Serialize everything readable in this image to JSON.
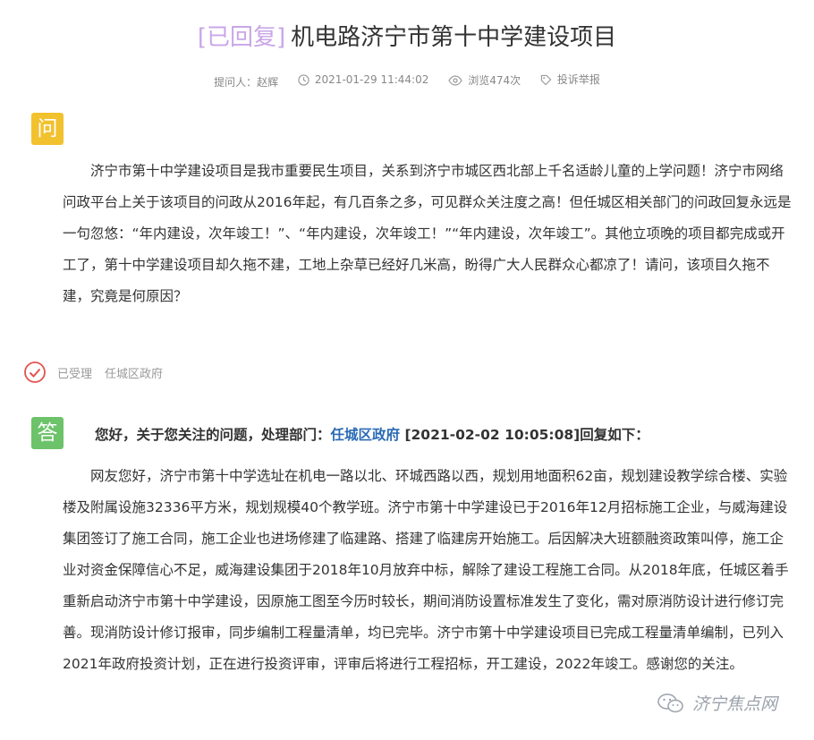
{
  "header": {
    "status_tag": "[已回复]",
    "title": "机电路济宁市第十中学建设项目"
  },
  "meta": {
    "asker": "提问人：赵辉",
    "datetime": "2021-01-29 11:44:02",
    "views": "浏览474次",
    "report": "投诉举报"
  },
  "question": {
    "badge": "问",
    "body": "济宁市第十中学建设项目是我市重要民生项目，关系到济宁市城区西北部上千名适龄儿童的上学问题！济宁市网络问政平台上关于该项目的问政从2016年起，有几百条之多，可见群众关注度之高！但任城区相关部门的问政回复永远是一句忽悠：“年内建设，次年竣工！”、“年内建设，次年竣工！”“年内建设，次年竣工”。其他立项晚的项目都完成或开工了，第十中学建设项目却久拖不建，工地上杂草已经好几米高，盼得广大人民群众心都凉了！请问，该项目久拖不建，究竟是何原因？"
  },
  "status": {
    "accepted": "已受理",
    "department": "任城区政府"
  },
  "answer": {
    "badge": "答",
    "head_prefix": "您好，关于您关注的问题，处理部门：",
    "head_department": "任城区政府",
    "head_suffix": "[2021-02-02 10:05:08]回复如下：",
    "body": "网友您好，济宁市第十中学选址在机电一路以北、环城西路以西，规划用地面积62亩，规划建设教学综合楼、实验楼及附属设施32336平方米，规划规模40个教学班。济宁市第十中学建设已于2016年12月招标施工企业，与威海建设集团签订了施工合同，施工企业也进场修建了临建路、搭建了临建房开始施工。后因解决大班额融资政策叫停，施工企业对资金保障信心不足，威海建设集团于2018年10月放弃中标，解除了建设工程施工合同。从2018年底，任城区着手重新启动济宁市第十中学建设，因原施工图至今历时较长，期间消防设置标准发生了变化，需对原消防设计进行修订完善。现消防设计修订报审，同步编制工程量清单，均已完毕。济宁市第十中学建设项目已完成工程量清单编制，已列入2021年政府投资计划，正在进行投资评审，评审后将进行工程招标，开工建设，2022年竣工。感谢您的关注。"
  },
  "watermark": {
    "text": "济宁焦点网"
  },
  "colors": {
    "status_tag": "#c9a6e8",
    "question_badge": "#f2c12e",
    "answer_badge": "#6cc36a",
    "link": "#2a6bb5",
    "accepted_icon": "#e2534d"
  }
}
